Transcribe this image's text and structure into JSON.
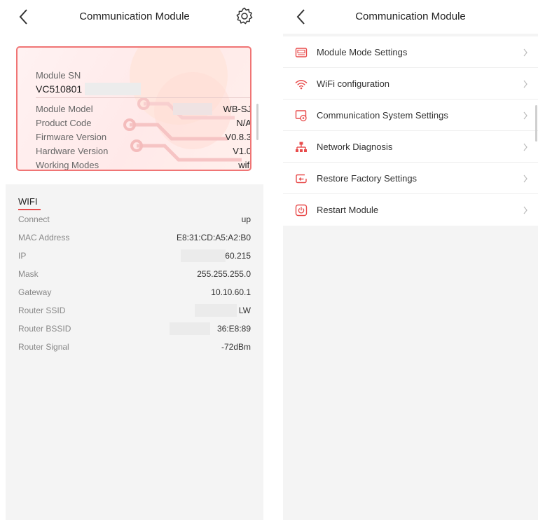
{
  "left_screen": {
    "header": {
      "title": "Communication Module"
    },
    "module_info": {
      "sn_label": "Module SN",
      "sn_value": "VC510801",
      "rows": [
        {
          "label": "Module Model",
          "value": "WB-SJ"
        },
        {
          "label": "Product Code",
          "value": "N/A"
        },
        {
          "label": "Firmware Version",
          "value": "V0.8.3"
        },
        {
          "label": "Hardware Version",
          "value": "V1.0"
        },
        {
          "label": "Working Modes",
          "value": "wifi"
        }
      ]
    },
    "wifi": {
      "title": "WIFI",
      "rows": [
        {
          "label": "Connect",
          "value": "up"
        },
        {
          "label": "MAC Address",
          "value": "E8:31:CD:A5:A2:B0"
        },
        {
          "label": "IP",
          "value": "60.215"
        },
        {
          "label": "Mask",
          "value": "255.255.255.0"
        },
        {
          "label": "Gateway",
          "value": "10.10.60.1"
        },
        {
          "label": "Router SSID",
          "value": "LW"
        },
        {
          "label": "Router BSSID",
          "value": "36:E8:89"
        },
        {
          "label": "Router Signal",
          "value": "-72dBm"
        }
      ]
    }
  },
  "right_screen": {
    "header": {
      "title": "Communication Module"
    },
    "menu": [
      {
        "label": "Module Mode Settings",
        "icon": "module-mode-icon"
      },
      {
        "label": "WiFi configuration",
        "icon": "wifi-icon"
      },
      {
        "label": "Communication System Settings",
        "icon": "system-settings-icon"
      },
      {
        "label": "Network Diagnosis",
        "icon": "network-icon"
      },
      {
        "label": "Restore Factory Settings",
        "icon": "restore-icon"
      },
      {
        "label": "Restart Module",
        "icon": "power-icon"
      }
    ]
  },
  "colors": {
    "accent": "#e84c4c",
    "card_border": "#f07575",
    "background": "#f4f4f4"
  }
}
